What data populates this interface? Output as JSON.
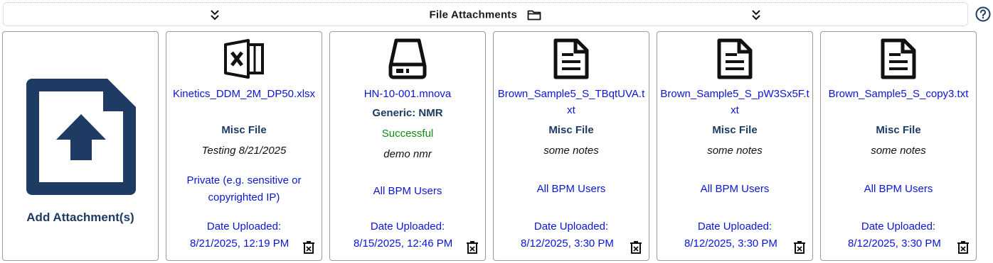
{
  "header": {
    "title": "File Attachments",
    "collapse_icon": "chevron-double-down-icon",
    "folder_icon": "folder-open-icon",
    "help_icon": "help-circle-icon"
  },
  "add_card": {
    "label": "Add Attachment(s)",
    "icon": "file-upload-icon"
  },
  "files": [
    {
      "icon": "excel-file-icon",
      "name": "Kinetics_DDM_2M_DP50.xlsx",
      "type": "Misc File",
      "status": "",
      "note": "Testing 8/21/2025",
      "access": "Private (e.g. sensitive or copyrighted IP)",
      "date_label": "Date Uploaded:",
      "date": "8/21/2025, 12:19 PM"
    },
    {
      "icon": "hard-drive-icon",
      "name": "HN-10-001.mnova",
      "type": "Generic: NMR",
      "status": "Successful",
      "note": "demo nmr",
      "access": "All BPM Users",
      "date_label": "Date Uploaded:",
      "date": "8/15/2025, 12:46 PM"
    },
    {
      "icon": "text-file-icon",
      "name": "Brown_Sample5_S_TBqtUVA.txt",
      "type": "Misc File",
      "status": "",
      "note": "some notes",
      "access": "All BPM Users",
      "date_label": "Date Uploaded:",
      "date": "8/12/2025, 3:30 PM"
    },
    {
      "icon": "text-file-icon",
      "name": "Brown_Sample5_S_pW3Sx5F.txt",
      "type": "Misc File",
      "status": "",
      "note": "some notes",
      "access": "All BPM Users",
      "date_label": "Date Uploaded:",
      "date": "8/12/2025, 3:30 PM"
    },
    {
      "icon": "text-file-icon",
      "name": "Brown_Sample5_S_copy3.txt",
      "type": "Misc File",
      "status": "",
      "note": "some notes",
      "access": "All BPM Users",
      "date_label": "Date Uploaded:",
      "date": "8/12/2025, 3:30 PM"
    }
  ],
  "colors": {
    "link": "#0a15d6",
    "navy": "#1d3b63",
    "success": "#108a10",
    "card_border": "#9a9a9a"
  }
}
